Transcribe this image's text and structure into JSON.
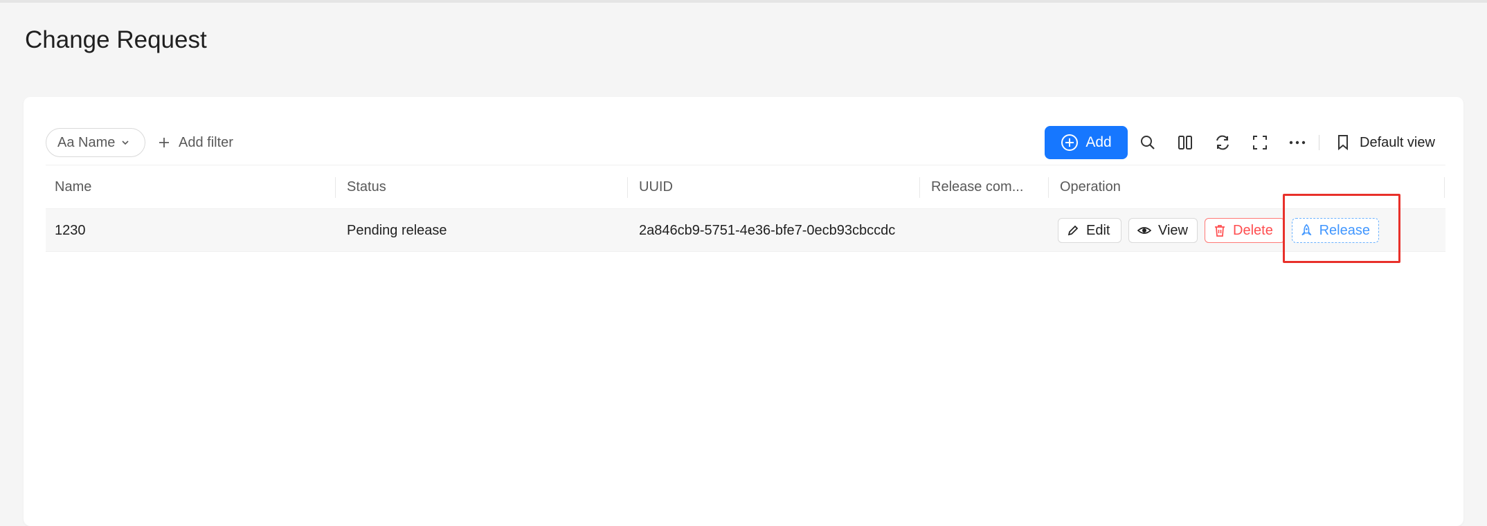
{
  "page": {
    "title": "Change Request"
  },
  "toolbar": {
    "name_filter_label": "Aa Name",
    "add_filter_label": "Add filter",
    "add_button_label": "Add",
    "default_view_label": "Default view",
    "icons": [
      "search-icon",
      "columns-icon",
      "refresh-icon",
      "fullscreen-icon",
      "more-icon",
      "bookmark-icon"
    ]
  },
  "table": {
    "columns": [
      "Name",
      "Status",
      "UUID",
      "Release com...",
      "Operation"
    ],
    "rows": [
      {
        "name": "1230",
        "status": "Pending release",
        "uuid": "2a846cb9-5751-4e36-bfe7-0ecb93cbccdc",
        "release_comment": ""
      }
    ],
    "operations": {
      "edit": "Edit",
      "view": "View",
      "delete": "Delete",
      "release": "Release"
    }
  },
  "colors": {
    "primary": "#1677ff",
    "danger": "#ff4d4f",
    "highlight": "#e8302a"
  }
}
